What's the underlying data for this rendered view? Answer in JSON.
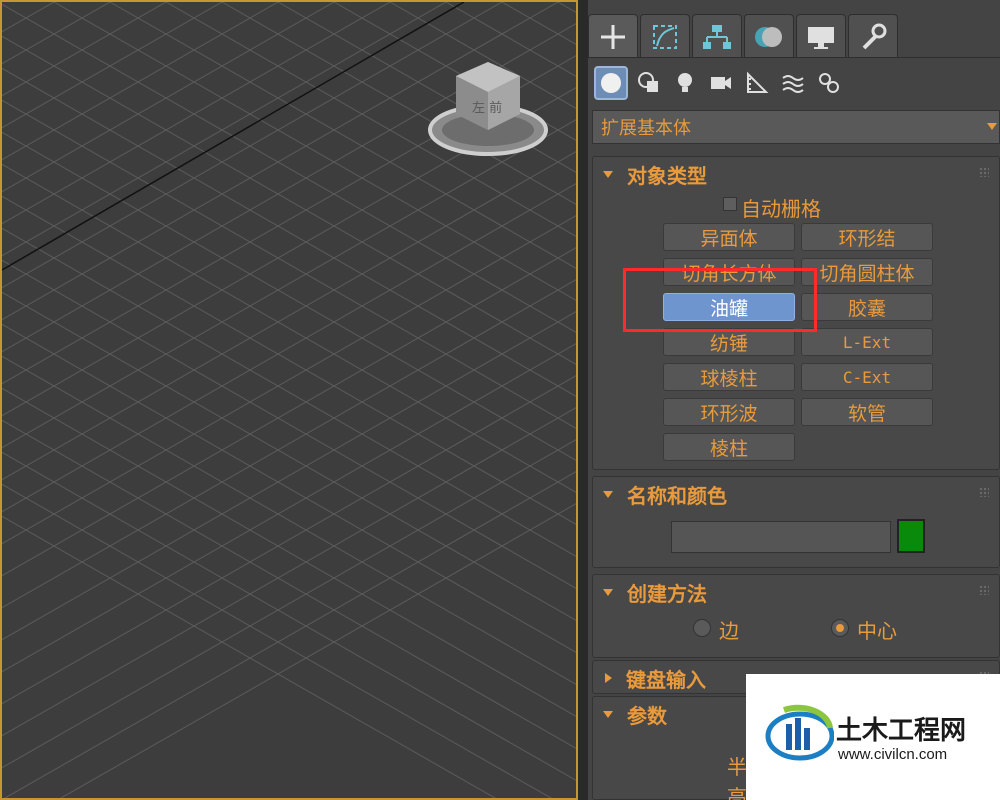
{
  "colors": {
    "accent": "#e89a3c",
    "selected": "#6f95cf",
    "object_color": "#0a8a0a",
    "highlight": "#ff2a2a"
  },
  "viewport": {
    "viewcube_face_text": "左 前"
  },
  "tabs": [
    {
      "name": "create",
      "icon": "plus-icon"
    },
    {
      "name": "modify",
      "icon": "modify-curve-icon"
    },
    {
      "name": "hierarchy",
      "icon": "hierarchy-icon"
    },
    {
      "name": "motion",
      "icon": "motion-icon"
    },
    {
      "name": "display",
      "icon": "display-monitor-icon"
    },
    {
      "name": "utilities",
      "icon": "wrench-icon"
    }
  ],
  "subtabs": [
    {
      "name": "geometry",
      "icon": "sphere-icon"
    },
    {
      "name": "shapes",
      "icon": "shapes-icon"
    },
    {
      "name": "lights",
      "icon": "light-bulb-icon"
    },
    {
      "name": "cameras",
      "icon": "camera-icon"
    },
    {
      "name": "helpers",
      "icon": "helper-ruler-icon"
    },
    {
      "name": "spacewarps",
      "icon": "wave-icon"
    },
    {
      "name": "systems",
      "icon": "gears-icon"
    }
  ],
  "category_dropdown": {
    "value": "扩展基本体"
  },
  "object_type": {
    "title": "对象类型",
    "autogrid_label": "自动栅格",
    "buttons": [
      "异面体",
      "环形结",
      "切角长方体",
      "切角圆柱体",
      "油罐",
      "胶囊",
      "纺锤",
      "L-Ext",
      "球棱柱",
      "C-Ext",
      "环形波",
      "软管",
      "棱柱"
    ],
    "selected": "油罐"
  },
  "name_color": {
    "title": "名称和颜色",
    "name_value": ""
  },
  "creation_method": {
    "title": "创建方法",
    "options": [
      "边",
      "中心"
    ],
    "selected": "中心"
  },
  "keyboard_entry": {
    "title": "键盘输入"
  },
  "parameters": {
    "title": "参数",
    "row1": "半",
    "row2": "高"
  },
  "watermark": {
    "title": "土木工程网",
    "url": "www.civilcn.com"
  }
}
